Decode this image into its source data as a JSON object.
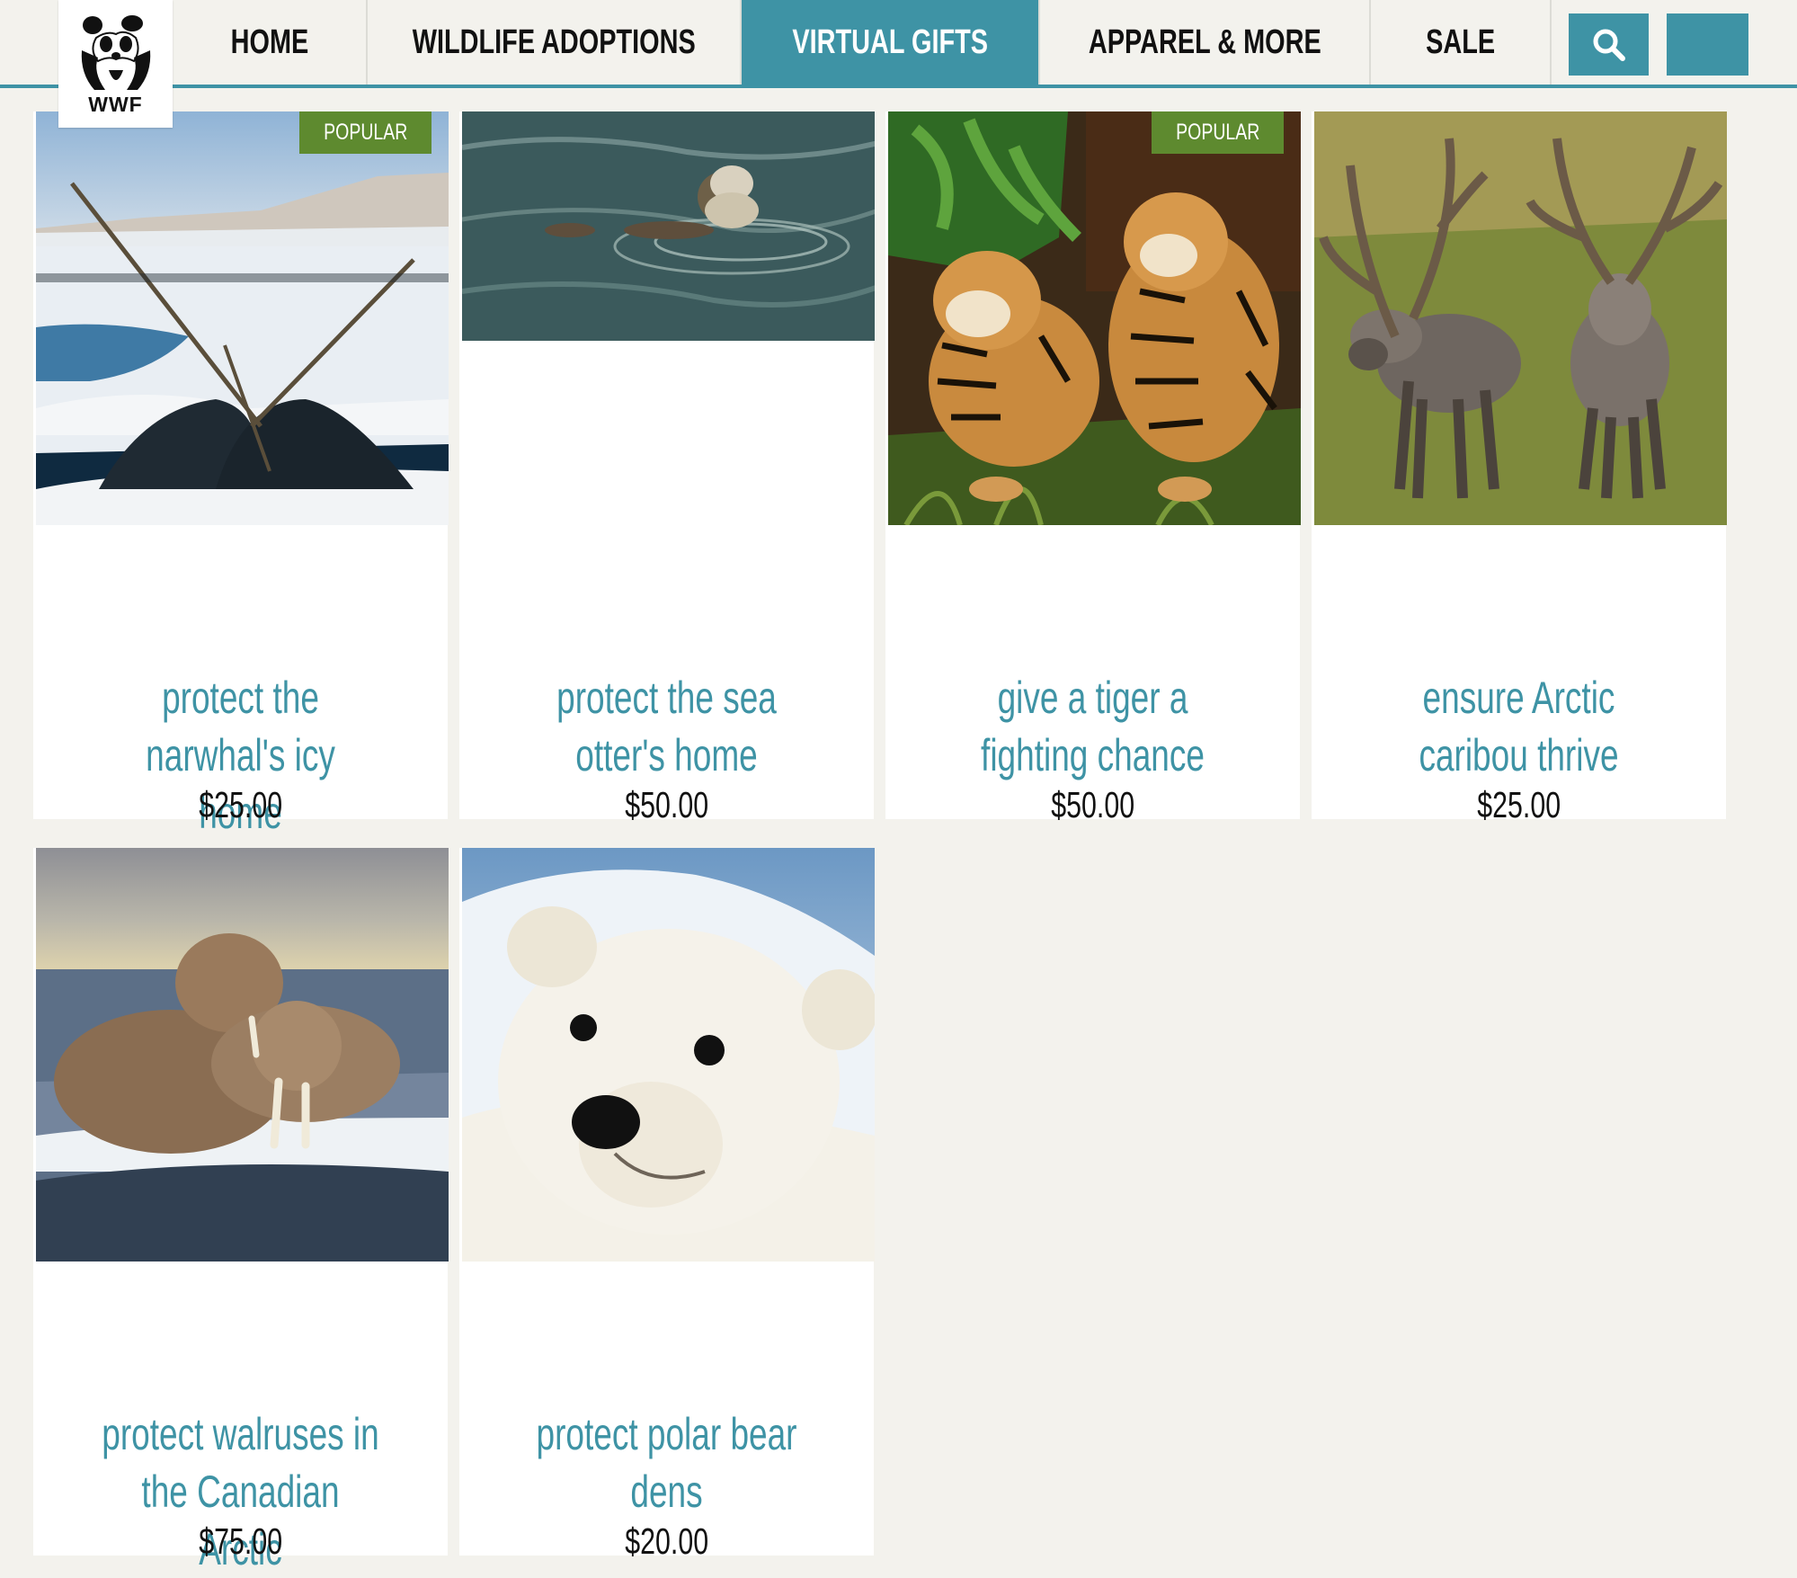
{
  "brand": {
    "logo_text": "WWF"
  },
  "nav": {
    "items": [
      {
        "label": "HOME",
        "active": false
      },
      {
        "label": "WILDLIFE ADOPTIONS",
        "active": false
      },
      {
        "label": "VIRTUAL GIFTS",
        "active": true
      },
      {
        "label": "APPAREL & MORE",
        "active": false
      },
      {
        "label": "SALE",
        "active": false
      }
    ],
    "search_icon": "search-icon",
    "cart_icon": "cart-icon"
  },
  "colors": {
    "accent": "#3e93a5",
    "badge": "#5e8a2f",
    "background": "#f3f2ed"
  },
  "products": [
    {
      "title": "protect the narwhal's icy home",
      "price": "$25.00",
      "badge": "POPULAR",
      "image": "narwhals"
    },
    {
      "title": "protect the sea otter's home",
      "price": "$50.00",
      "badge": "",
      "image": "sea-otter"
    },
    {
      "title": "give a tiger a fighting chance",
      "price": "$50.00",
      "badge": "POPULAR",
      "image": "tiger-cubs"
    },
    {
      "title": "ensure Arctic caribou thrive",
      "price": "$25.00",
      "badge": "",
      "image": "caribou"
    },
    {
      "title": "protect walruses in the Canadian Arctic",
      "price": "$75.00",
      "badge": "",
      "image": "walruses"
    },
    {
      "title": "protect polar bear dens",
      "price": "$20.00",
      "badge": "",
      "image": "polar-bear-cub"
    }
  ]
}
